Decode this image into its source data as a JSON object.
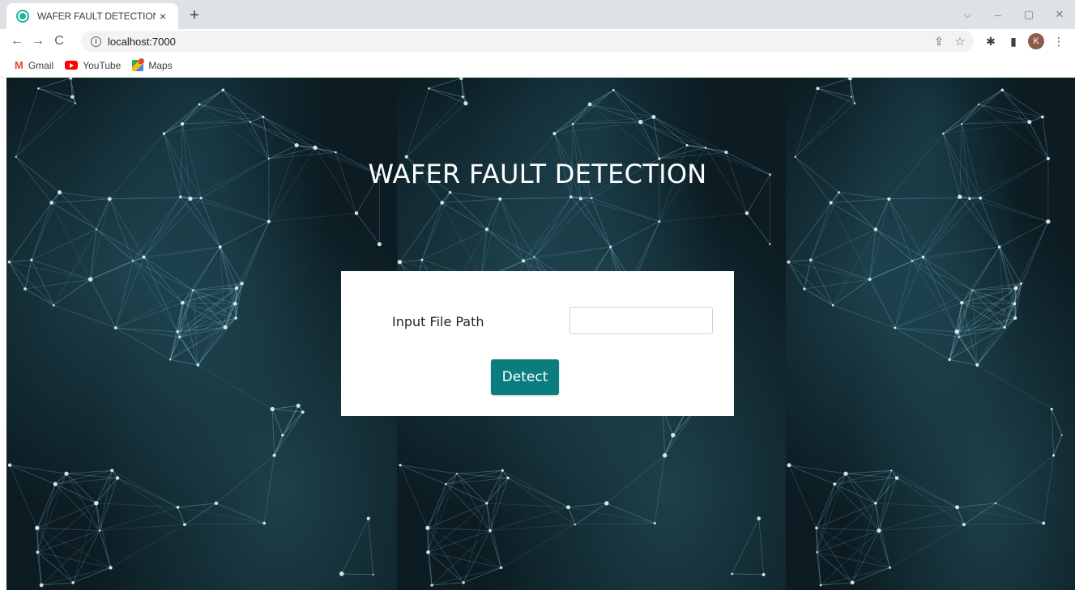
{
  "browser": {
    "tab": {
      "title": "WAFER FAULT DETECTION",
      "favicon": "app-favicon",
      "close_glyph": "×"
    },
    "new_tab_glyph": "+",
    "window_controls": {
      "dropdown": "⌵",
      "minimize": "–",
      "restore": "▢",
      "close": "✕"
    },
    "nav": {
      "back": "←",
      "forward": "→",
      "reload": "C"
    },
    "address": {
      "info_glyph": "i",
      "url": "localhost:7000"
    },
    "omnibox_icons": {
      "share": "⇪",
      "star": "☆"
    },
    "toolbar_icons": {
      "extensions": "✱",
      "side_panel": "▮",
      "menu": "⋮"
    },
    "profile": {
      "initial": "K",
      "color": "#8d5b4c"
    },
    "bookmarks": [
      {
        "label": "Gmail",
        "icon": "gmail-icon"
      },
      {
        "label": "YouTube",
        "icon": "youtube-icon"
      },
      {
        "label": "Maps",
        "icon": "maps-icon"
      }
    ]
  },
  "page": {
    "title": "WAFER FAULT DETECTION",
    "form": {
      "label": "Input File Path",
      "input_value": "",
      "button_label": "Detect",
      "button_color": "#0b7d7f"
    }
  }
}
